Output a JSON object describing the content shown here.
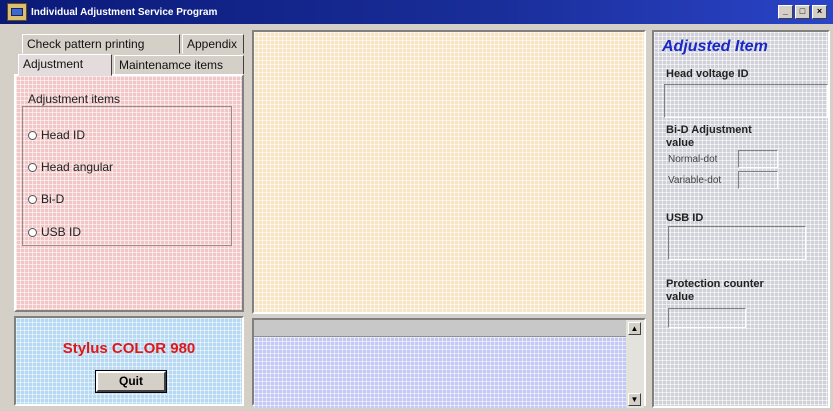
{
  "window": {
    "title": "Individual Adjustment Service Program",
    "buttons": [
      "_",
      "□",
      "×"
    ]
  },
  "tabs": {
    "row1": [
      "Check pattern printing",
      "Appendix"
    ],
    "row2": [
      "Adjustment",
      "Maintenamce items"
    ],
    "active": "Adjustment"
  },
  "adjustment_group": {
    "title": "Adjustment items",
    "options": [
      "Head ID",
      "Head angular",
      "Bi-D",
      "USB ID"
    ]
  },
  "model": {
    "name": "Stylus COLOR 980",
    "quit_label": "Quit"
  },
  "right": {
    "title": "Adjusted Item",
    "head_voltage_label": "Head voltage ID",
    "bid_label_line1": "Bi-D Adjustment",
    "bid_label_line2": "value",
    "normal_dot_label": "Normal-dot",
    "variable_dot_label": "Variable-dot",
    "usb_label": "USB ID",
    "protection_label_line1": "Protection counter",
    "protection_label_line2": "value"
  },
  "colors": {
    "title_accent": "#1a28c8",
    "model_red": "#e01818"
  }
}
